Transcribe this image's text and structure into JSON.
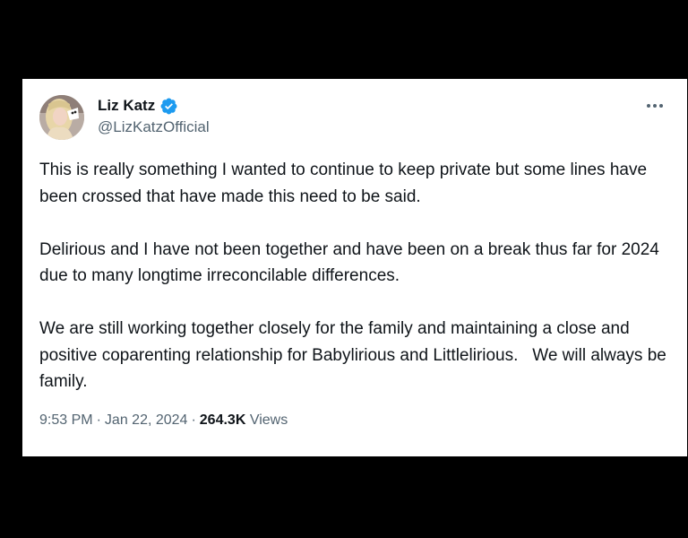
{
  "tweet": {
    "author": {
      "display_name": "Liz Katz",
      "handle": "@LizKatzOfficial",
      "verified": true,
      "avatar_icon": "avatar-photo"
    },
    "more_icon": "more-horizontal-icon",
    "paragraphs": [
      "This is really something I wanted to continue to keep private but some lines have been crossed that have made this need to be said.",
      "Delirious and I have not been together and have been on a break thus far for 2024 due to many longtime irreconcilable differences.",
      "We are still working together closely for the family and maintaining a close and positive coparenting relationship for Babylirious and Littlelirious.   We will always be family."
    ],
    "time": "9:53 PM",
    "separator": "·",
    "date": "Jan 22, 2024",
    "views_count": "264.3K",
    "views_label": "Views"
  },
  "colors": {
    "background": "#000000",
    "card": "#ffffff",
    "text": "#0f1419",
    "secondary": "#536471",
    "verified_badge": "#1d9bf0"
  }
}
